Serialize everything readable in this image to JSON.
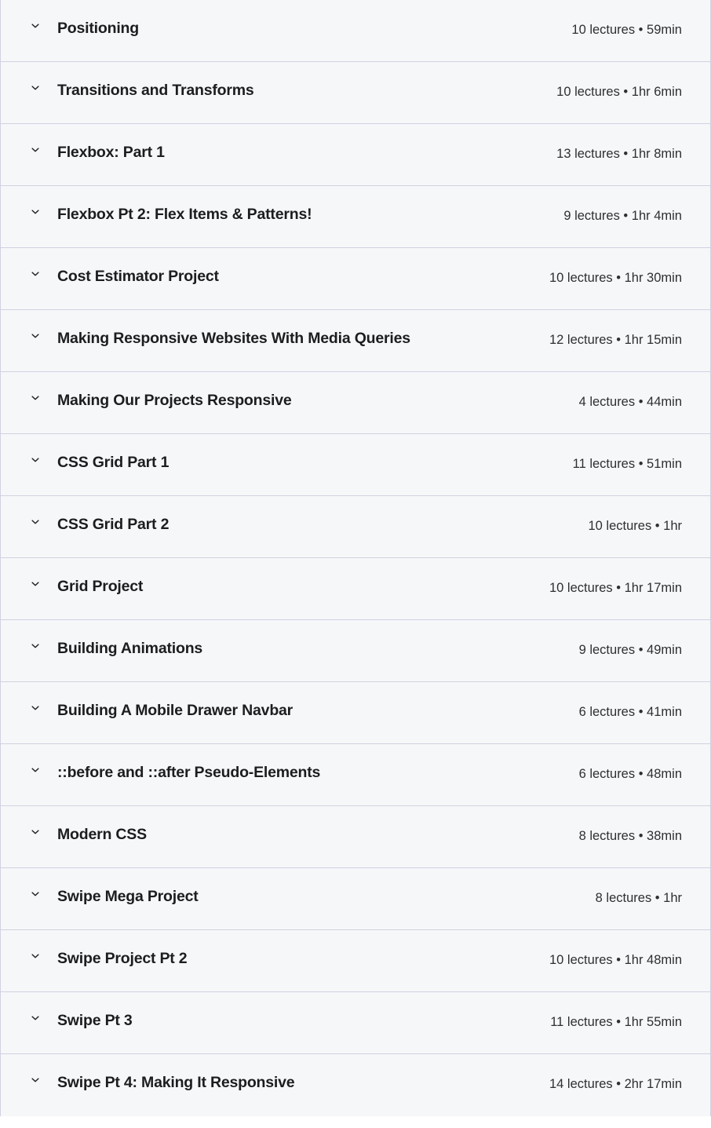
{
  "theme": {
    "row_background": "#f6f7f9",
    "divider_color": "#d1d2e0",
    "title_color": "#1c1d1f",
    "meta_color": "#2d2f31"
  },
  "icons": {
    "collapse_chevron": "chevron-down-icon"
  },
  "curriculum": {
    "sections": [
      {
        "title": "Positioning",
        "lectures": "10 lectures",
        "duration": "59min",
        "meta": "10 lectures • 59min"
      },
      {
        "title": "Transitions and Transforms",
        "lectures": "10 lectures",
        "duration": "1hr 6min",
        "meta": "10 lectures • 1hr 6min"
      },
      {
        "title": "Flexbox: Part 1",
        "lectures": "13 lectures",
        "duration": "1hr 8min",
        "meta": "13 lectures • 1hr 8min"
      },
      {
        "title": "Flexbox Pt 2: Flex Items & Patterns!",
        "lectures": "9 lectures",
        "duration": "1hr 4min",
        "meta": "9 lectures • 1hr 4min"
      },
      {
        "title": "Cost Estimator Project",
        "lectures": "10 lectures",
        "duration": "1hr 30min",
        "meta": "10 lectures • 1hr 30min"
      },
      {
        "title": "Making Responsive Websites With Media Queries",
        "lectures": "12 lectures",
        "duration": "1hr 15min",
        "meta": "12 lectures • 1hr 15min"
      },
      {
        "title": "Making Our Projects Responsive",
        "lectures": "4 lectures",
        "duration": "44min",
        "meta": "4 lectures • 44min"
      },
      {
        "title": "CSS Grid Part 1",
        "lectures": "11 lectures",
        "duration": "51min",
        "meta": "11 lectures • 51min"
      },
      {
        "title": "CSS Grid Part 2",
        "lectures": "10 lectures",
        "duration": "1hr",
        "meta": "10 lectures • 1hr"
      },
      {
        "title": "Grid Project",
        "lectures": "10 lectures",
        "duration": "1hr 17min",
        "meta": "10 lectures • 1hr 17min"
      },
      {
        "title": "Building Animations",
        "lectures": "9 lectures",
        "duration": "49min",
        "meta": "9 lectures • 49min"
      },
      {
        "title": "Building A Mobile Drawer Navbar",
        "lectures": "6 lectures",
        "duration": "41min",
        "meta": "6 lectures • 41min"
      },
      {
        "title": "::before and ::after Pseudo-Elements",
        "lectures": "6 lectures",
        "duration": "48min",
        "meta": "6 lectures • 48min"
      },
      {
        "title": "Modern CSS",
        "lectures": "8 lectures",
        "duration": "38min",
        "meta": "8 lectures • 38min"
      },
      {
        "title": "Swipe Mega Project",
        "lectures": "8 lectures",
        "duration": "1hr",
        "meta": "8 lectures • 1hr"
      },
      {
        "title": "Swipe Project Pt 2",
        "lectures": "10 lectures",
        "duration": "1hr 48min",
        "meta": "10 lectures • 1hr 48min"
      },
      {
        "title": "Swipe Pt 3",
        "lectures": "11 lectures",
        "duration": "1hr 55min",
        "meta": "11 lectures • 1hr 55min"
      },
      {
        "title": "Swipe Pt 4: Making It Responsive",
        "lectures": "14 lectures",
        "duration": "2hr 17min",
        "meta": "14 lectures • 2hr 17min"
      }
    ]
  }
}
